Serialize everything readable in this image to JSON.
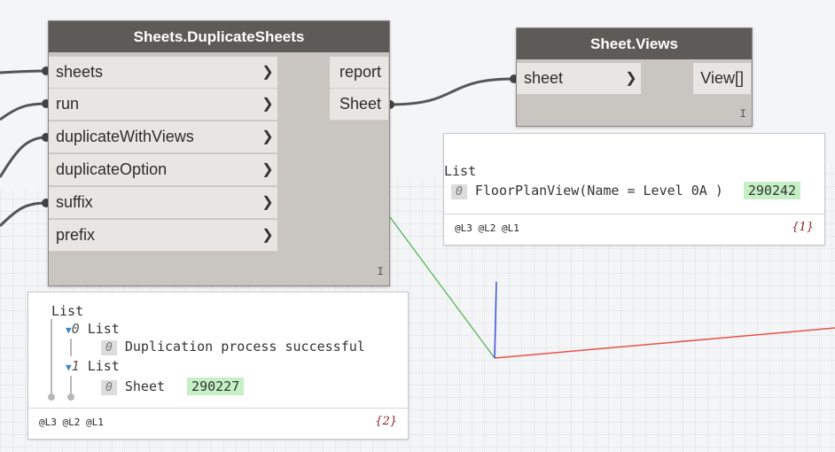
{
  "dup_node": {
    "title": "Sheets.DuplicateSheets",
    "inputs": [
      "sheets",
      "run",
      "duplicateWithViews",
      "duplicateOption",
      "suffix",
      "prefix"
    ],
    "outputs": [
      "report",
      "Sheet"
    ],
    "lacing": "I"
  },
  "views_node": {
    "title": "Sheet.Views",
    "inputs": [
      "sheet"
    ],
    "outputs": [
      "View[]"
    ],
    "lacing": "I"
  },
  "views_preview": {
    "root": "List",
    "item_index": "0",
    "item_text": "FloorPlanView(Name = Level 0A )",
    "item_id": "290242",
    "levels": "@L3 @L2 @L1",
    "count": "{1}"
  },
  "dup_preview": {
    "root": "List",
    "sub1_index": "0",
    "sub1_label": "List",
    "sub1_item_index": "0",
    "sub1_item_text": "Duplication process successful",
    "sub2_index": "1",
    "sub2_label": "List",
    "sub2_item_index": "0",
    "sub2_item_text": "Sheet",
    "sub2_item_id": "290227",
    "levels": "@L3 @L2 @L1",
    "count": "{2}"
  },
  "icons": {
    "port_arrow": "chevron-right-icon",
    "expand": "triangle-down-icon"
  },
  "colors": {
    "node_header": "#5d5b58",
    "node_body": "#c9c6c1",
    "port": "#e8e6e2",
    "highlight": "#c5f0c5",
    "axis_x": "#e8524a",
    "axis_y": "#4caf50",
    "axis_z": "#3b52d6"
  }
}
